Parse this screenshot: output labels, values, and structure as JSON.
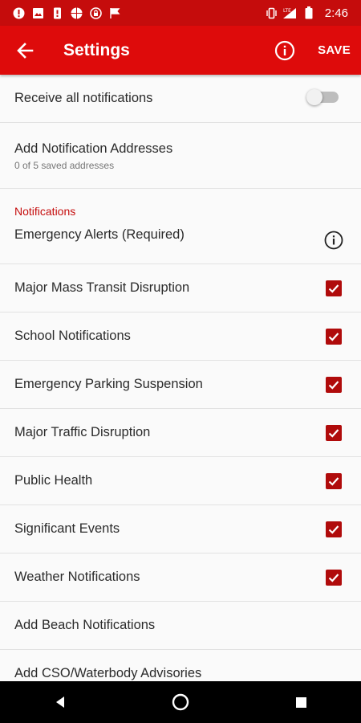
{
  "status_bar": {
    "time": "2:46",
    "network": "LTE"
  },
  "app_bar": {
    "title": "Settings",
    "save_label": "SAVE"
  },
  "receive_all": {
    "label": "Receive all notifications",
    "enabled": false
  },
  "addresses": {
    "label": "Add Notification Addresses",
    "subtext": "0 of 5 saved addresses"
  },
  "notifications": {
    "header": "Notifications",
    "emergency": "Emergency Alerts (Required)",
    "items": [
      {
        "label": "Major Mass Transit Disruption",
        "checked": true
      },
      {
        "label": "School Notifications",
        "checked": true
      },
      {
        "label": "Emergency Parking Suspension",
        "checked": true
      },
      {
        "label": "Major Traffic Disruption",
        "checked": true
      },
      {
        "label": "Public Health",
        "checked": true
      },
      {
        "label": "Significant Events",
        "checked": true
      },
      {
        "label": "Weather Notifications",
        "checked": true
      }
    ],
    "extras": [
      {
        "label": "Add Beach Notifications"
      },
      {
        "label": "Add CSO/Waterbody Advisories"
      }
    ]
  },
  "colors": {
    "status_bar": "#c50c0c",
    "app_bar": "#de0b0b",
    "accent": "#b00b0b"
  }
}
